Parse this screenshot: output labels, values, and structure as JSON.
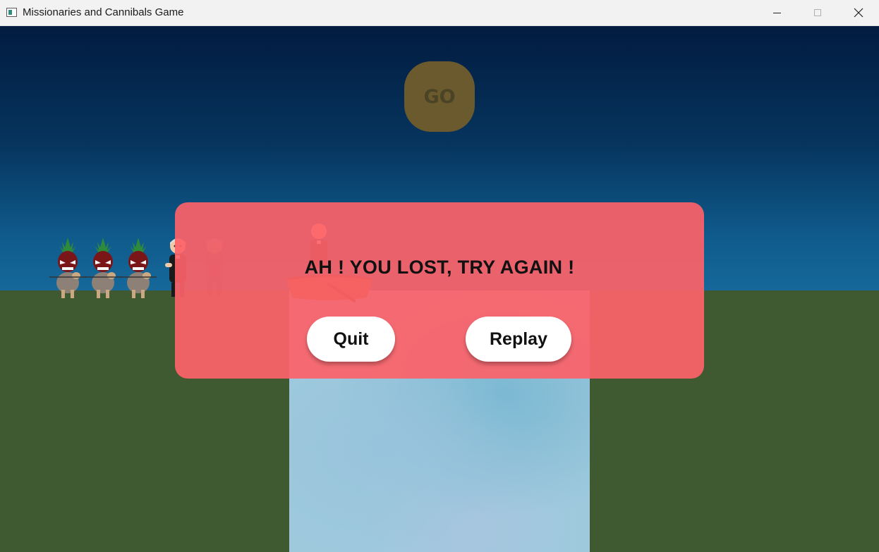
{
  "window": {
    "title": "Missionaries and Cannibals Game",
    "controls": [
      "minimize",
      "maximize",
      "close"
    ]
  },
  "game": {
    "go_label": "GO",
    "left_bank": {
      "cannibals": 3,
      "missionaries": 2
    },
    "boat": {
      "missionaries": 1,
      "cannibals": 0
    }
  },
  "dialog": {
    "message": "AH ! YOU LOST, TRY AGAIN !",
    "quit_label": "Quit",
    "replay_label": "Replay"
  },
  "colors": {
    "sky_top": "#021b40",
    "sky_bottom": "#16689a",
    "grass": "#3f5a31",
    "river": "#9ec9dd",
    "go_button": "#6b5a2d",
    "dialog": "#fd6268"
  }
}
